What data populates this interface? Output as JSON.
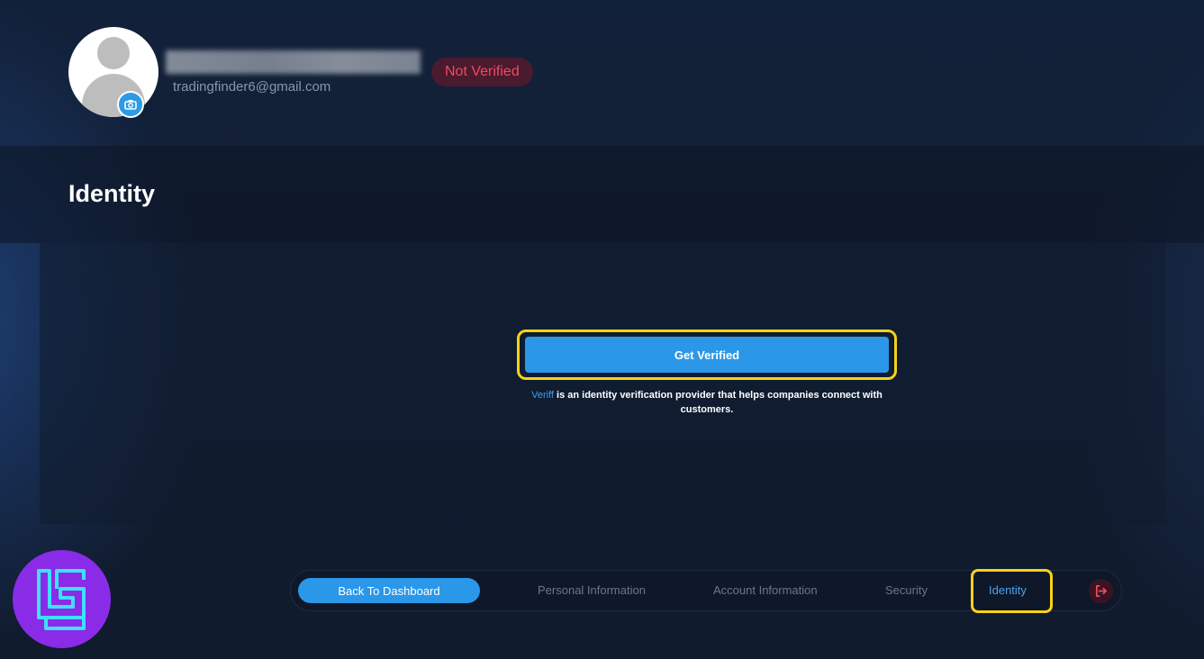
{
  "profile": {
    "email": "tradingfinder6@gmail.com",
    "status": "Not Verified",
    "avatar_icon": "user-silhouette-icon",
    "camera_icon": "camera-icon"
  },
  "identity": {
    "title": "Identity",
    "get_verified_label": "Get Verified",
    "veriff_link": "Veriff",
    "info_text": " is an identity verification provider that helps companies connect with customers."
  },
  "nav": {
    "back_label": "Back To Dashboard",
    "items": [
      {
        "label": "Personal Information",
        "active": false
      },
      {
        "label": "Account Information",
        "active": false
      },
      {
        "label": "Security",
        "active": false
      },
      {
        "label": "Identity",
        "active": true
      }
    ],
    "logout_icon": "logout-icon"
  },
  "colors": {
    "accent": "#2b97e8",
    "status_text": "#f04a5e",
    "highlight": "#f5d21a",
    "brand": "#8a2be8"
  }
}
